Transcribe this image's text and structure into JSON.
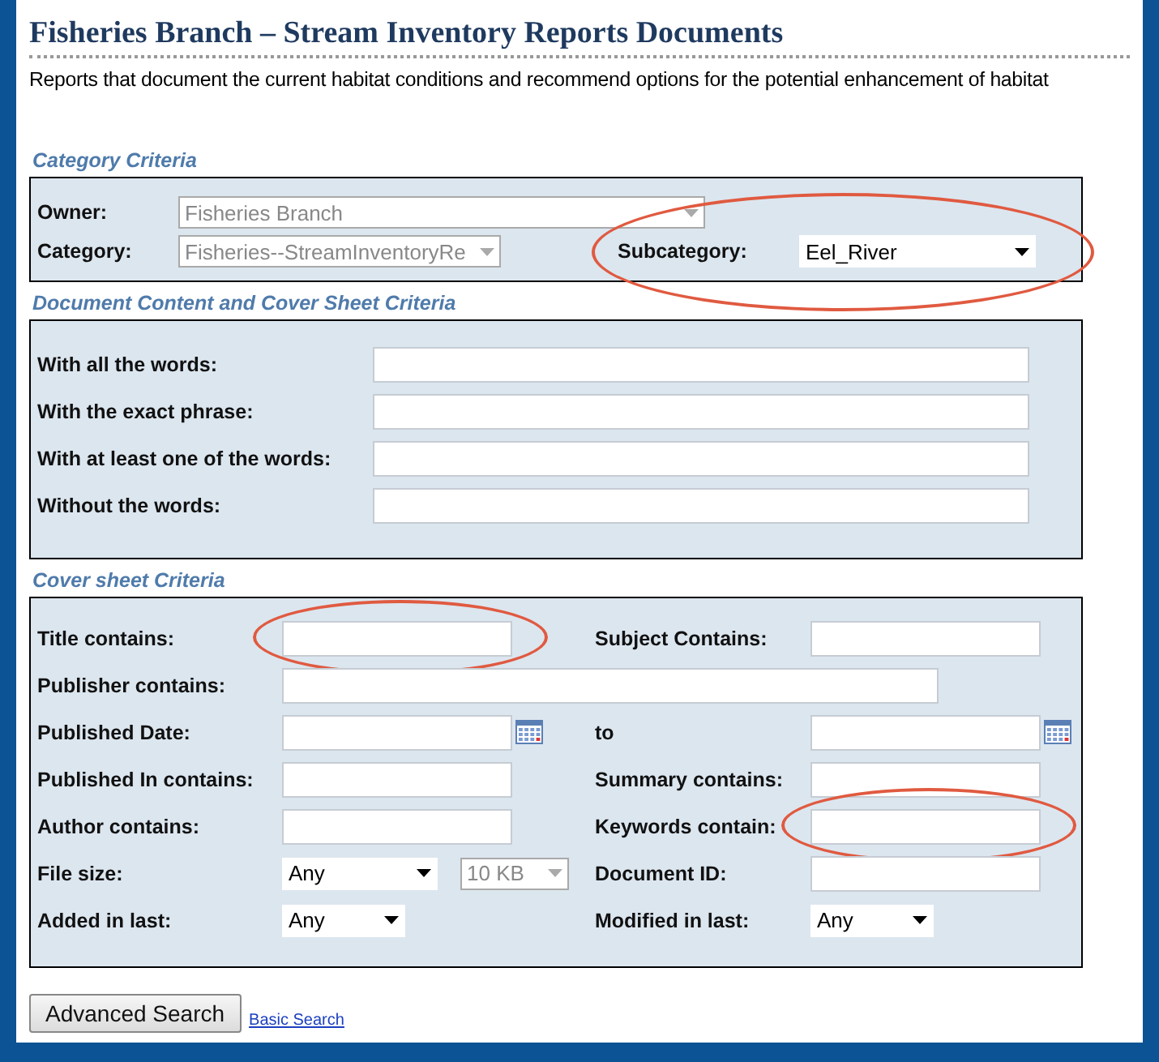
{
  "title": "Fisheries Branch – Stream Inventory Reports Documents",
  "description": "Reports that document the current habitat conditions and recommend options for the potential enhancement of habitat",
  "category_criteria": {
    "heading": "Category Criteria",
    "fields": [
      {
        "label": "Owner:",
        "value": "Fisheries Branch",
        "disabled": true
      },
      {
        "label": "Category:",
        "value": "Fisheries--StreamInventoryRe",
        "disabled": true
      },
      {
        "label": "Subcategory:",
        "value": "Eel_River",
        "disabled": false,
        "highlighted": true
      }
    ]
  },
  "content_criteria": {
    "heading": "Document Content and Cover Sheet Criteria",
    "fields": [
      {
        "label": "With all the words:"
      },
      {
        "label": "With the exact phrase:"
      },
      {
        "label": "With at least one of the words:"
      },
      {
        "label": "Without the words:"
      }
    ]
  },
  "cover_sheet": {
    "heading": "Cover sheet Criteria",
    "rows": [
      {
        "cells": [
          {
            "label": "Title contains:",
            "controls": [
              {
                "kind": "text",
                "highlighted": true
              }
            ]
          },
          {
            "label": "Subject Contains:",
            "controls": [
              {
                "kind": "text"
              }
            ]
          }
        ]
      },
      {
        "cells": [
          {
            "label": "Publisher contains:",
            "controls": [
              {
                "kind": "wide_text"
              }
            ]
          }
        ]
      },
      {
        "cells": [
          {
            "label": "Published Date:",
            "controls": [
              {
                "kind": "date"
              }
            ]
          },
          {
            "label": "to",
            "controls": [
              {
                "kind": "date"
              }
            ]
          }
        ]
      },
      {
        "cells": [
          {
            "label": "Published In contains:",
            "controls": [
              {
                "kind": "text"
              }
            ]
          },
          {
            "label": "Summary contains:",
            "controls": [
              {
                "kind": "text"
              }
            ]
          }
        ]
      },
      {
        "cells": [
          {
            "label": "Author contains:",
            "controls": [
              {
                "kind": "text"
              }
            ]
          },
          {
            "label": "Keywords contain:",
            "controls": [
              {
                "kind": "text",
                "highlighted": true
              }
            ]
          }
        ]
      },
      {
        "cells": [
          {
            "label": "File size:",
            "controls": [
              {
                "kind": "select",
                "value": "Any",
                "disabled": false
              },
              {
                "kind": "small_select",
                "value": "10 KB",
                "disabled": true
              }
            ]
          },
          {
            "label": "Document ID:",
            "controls": [
              {
                "kind": "text"
              }
            ]
          }
        ]
      },
      {
        "cells": [
          {
            "label": "Added in last:",
            "controls": [
              {
                "kind": "short_select",
                "value": "Any",
                "disabled": false
              }
            ]
          },
          {
            "label": "Modified in last:",
            "controls": [
              {
                "kind": "short_select",
                "value": "Any",
                "disabled": false
              }
            ]
          }
        ]
      }
    ]
  },
  "actions": {
    "button": "Advanced Search",
    "link": "Basic Search"
  }
}
